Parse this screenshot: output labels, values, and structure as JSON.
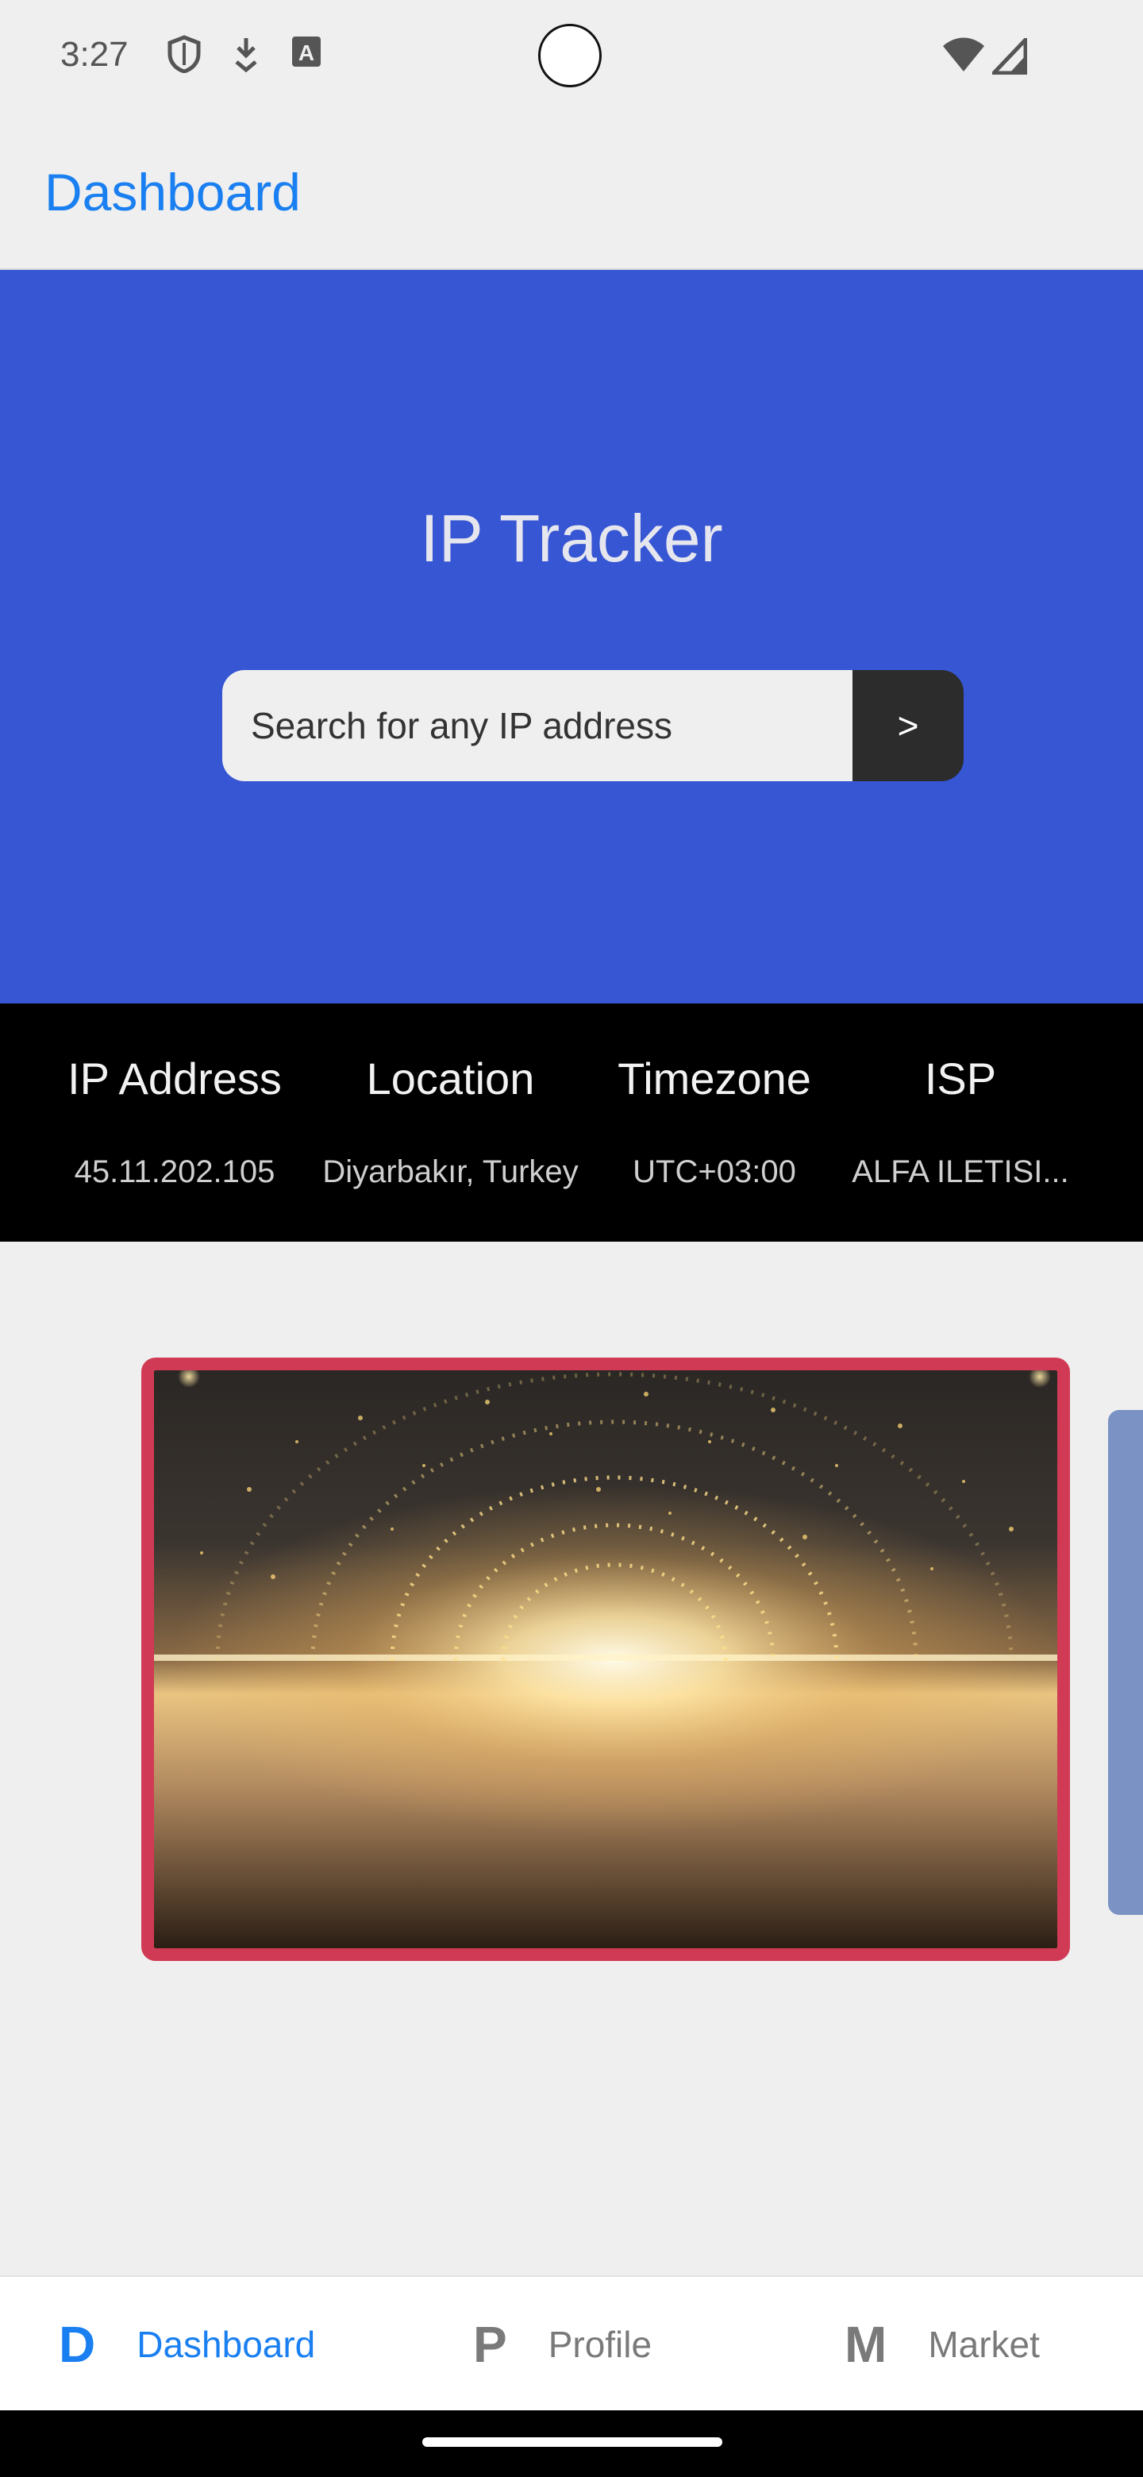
{
  "status_bar": {
    "time": "3:27",
    "icons_left": [
      "shield-icon",
      "download-icon",
      "keyboard-a-icon"
    ],
    "icons_right": [
      "wifi-icon",
      "signal-icon"
    ]
  },
  "app_bar": {
    "title": "Dashboard"
  },
  "hero": {
    "title": "IP Tracker",
    "search_placeholder": "Search for any IP address",
    "search_button": ">"
  },
  "info": {
    "columns": [
      {
        "header": "IP Address",
        "value": "45.11.202.105"
      },
      {
        "header": "Location",
        "value": "Diyarbakır, Turkey"
      },
      {
        "header": "Timezone",
        "value": "UTC+03:00"
      },
      {
        "header": "ISP",
        "value": "ALFA ILETISI..."
      }
    ]
  },
  "bottom_nav": {
    "items": [
      {
        "letter": "D",
        "label": "Dashboard",
        "active": true
      },
      {
        "letter": "P",
        "label": "Profile",
        "active": false
      },
      {
        "letter": "M",
        "label": "Market",
        "active": false
      }
    ]
  },
  "colors": {
    "accent": "#1a7ff0",
    "hero_bg": "#3656d3",
    "info_bg": "#000000",
    "card_border": "#d13a55"
  }
}
